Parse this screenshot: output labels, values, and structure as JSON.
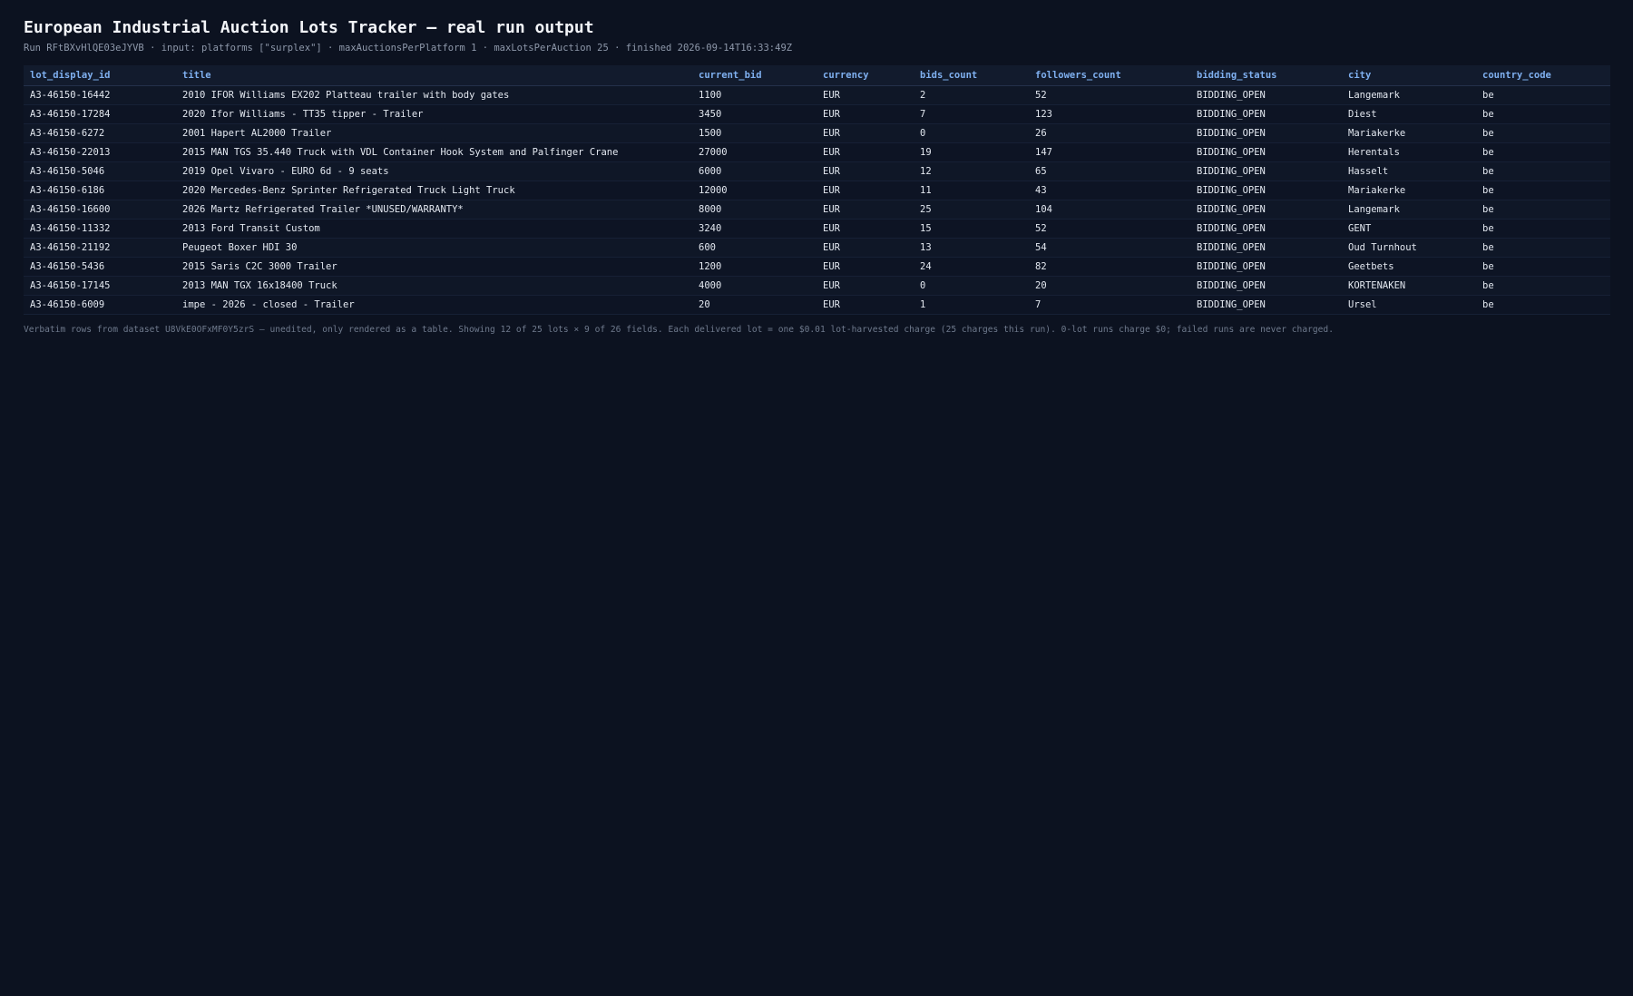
{
  "page": {
    "title": "European Industrial Auction Lots Tracker — real run output",
    "subtitle": "Run RFtBXvHlQE03eJYVB · input: platforms [\"surplex\"] · maxAuctionsPerPlatform 1 · maxLotsPerAuction 25 · finished 2026-09-14T16:33:49Z",
    "footer": "Verbatim rows from dataset U8VkE0OFxMF0Y5zrS — unedited, only rendered as a table. Showing 12 of 25 lots × 9 of 26 fields. Each delivered lot = one $0.01 lot-harvested charge (25 charges this run). 0-lot runs charge $0; failed runs are never charged."
  },
  "table": {
    "columns": [
      "lot_display_id",
      "title",
      "current_bid",
      "currency",
      "bids_count",
      "followers_count",
      "bidding_status",
      "city",
      "country_code"
    ],
    "rows": [
      [
        "A3-46150-16442",
        "2010 IFOR Williams EX202 Platteau trailer with body gates",
        "1100",
        "EUR",
        "2",
        "52",
        "BIDDING_OPEN",
        "Langemark",
        "be"
      ],
      [
        "A3-46150-17284",
        "2020 Ifor Williams - TT35 tipper - Trailer",
        "3450",
        "EUR",
        "7",
        "123",
        "BIDDING_OPEN",
        "Diest",
        "be"
      ],
      [
        "A3-46150-6272",
        "2001 Hapert AL2000 Trailer",
        "1500",
        "EUR",
        "0",
        "26",
        "BIDDING_OPEN",
        "Mariakerke",
        "be"
      ],
      [
        "A3-46150-22013",
        "2015 MAN TGS 35.440 Truck with VDL Container Hook System and Palfinger Crane",
        "27000",
        "EUR",
        "19",
        "147",
        "BIDDING_OPEN",
        "Herentals",
        "be"
      ],
      [
        "A3-46150-5046",
        "2019 Opel Vivaro - EURO 6d - 9 seats",
        "6000",
        "EUR",
        "12",
        "65",
        "BIDDING_OPEN",
        "Hasselt",
        "be"
      ],
      [
        "A3-46150-6186",
        "2020 Mercedes-Benz Sprinter Refrigerated Truck Light Truck",
        "12000",
        "EUR",
        "11",
        "43",
        "BIDDING_OPEN",
        "Mariakerke",
        "be"
      ],
      [
        "A3-46150-16600",
        "2026 Martz Refrigerated Trailer *UNUSED/WARRANTY*",
        "8000",
        "EUR",
        "25",
        "104",
        "BIDDING_OPEN",
        "Langemark",
        "be"
      ],
      [
        "A3-46150-11332",
        "2013 Ford Transit Custom",
        "3240",
        "EUR",
        "15",
        "52",
        "BIDDING_OPEN",
        "GENT",
        "be"
      ],
      [
        "A3-46150-21192",
        "Peugeot Boxer HDI 30",
        "600",
        "EUR",
        "13",
        "54",
        "BIDDING_OPEN",
        "Oud Turnhout",
        "be"
      ],
      [
        "A3-46150-5436",
        "2015 Saris C2C 3000 Trailer",
        "1200",
        "EUR",
        "24",
        "82",
        "BIDDING_OPEN",
        "Geetbets",
        "be"
      ],
      [
        "A3-46150-17145",
        "2013 MAN TGX 16x18400 Truck",
        "4000",
        "EUR",
        "0",
        "20",
        "BIDDING_OPEN",
        "KORTENAKEN",
        "be"
      ],
      [
        "A3-46150-6009",
        "impe - 2026 - closed - Trailer",
        "20",
        "EUR",
        "1",
        "7",
        "BIDDING_OPEN",
        "Ursel",
        "be"
      ]
    ]
  },
  "colors": {
    "background": "#0c1220",
    "header_text": "#7fb0f0",
    "body_text": "#e3e8f0",
    "muted_text": "#8e98aa"
  }
}
